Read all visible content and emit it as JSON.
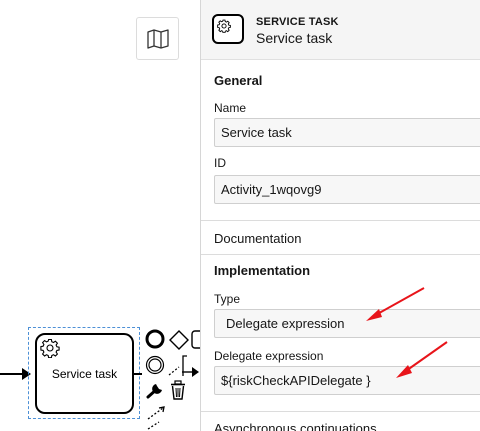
{
  "canvas": {
    "task_label": "Service task",
    "icons": {
      "map": "map-icon",
      "gear": "gear-icon",
      "end_event": "end-event-icon",
      "gateway": "gateway-icon",
      "intermediate_event": "intermediate-event-icon",
      "connect": "connect-tool-icon",
      "wrench": "wrench-icon",
      "delete": "trash-icon"
    }
  },
  "panel": {
    "header": {
      "type_label": "SERVICE TASK",
      "name": "Service task",
      "icon": "gear-icon"
    },
    "general": {
      "title": "General",
      "name_label": "Name",
      "name_value": "Service task",
      "id_label": "ID",
      "id_value": "Activity_1wqovg9"
    },
    "documentation": {
      "title": "Documentation"
    },
    "implementation": {
      "title": "Implementation",
      "type_label": "Type",
      "type_value": "Delegate expression",
      "delegate_label": "Delegate expression",
      "delegate_value": "${riskCheckAPIDelegate }"
    },
    "async": {
      "title": "Asynchronous continuations"
    }
  },
  "colors": {
    "annotation_arrow": "#e8141a",
    "selection": "#4d90d6",
    "header_bg": "#f5f5f5"
  }
}
